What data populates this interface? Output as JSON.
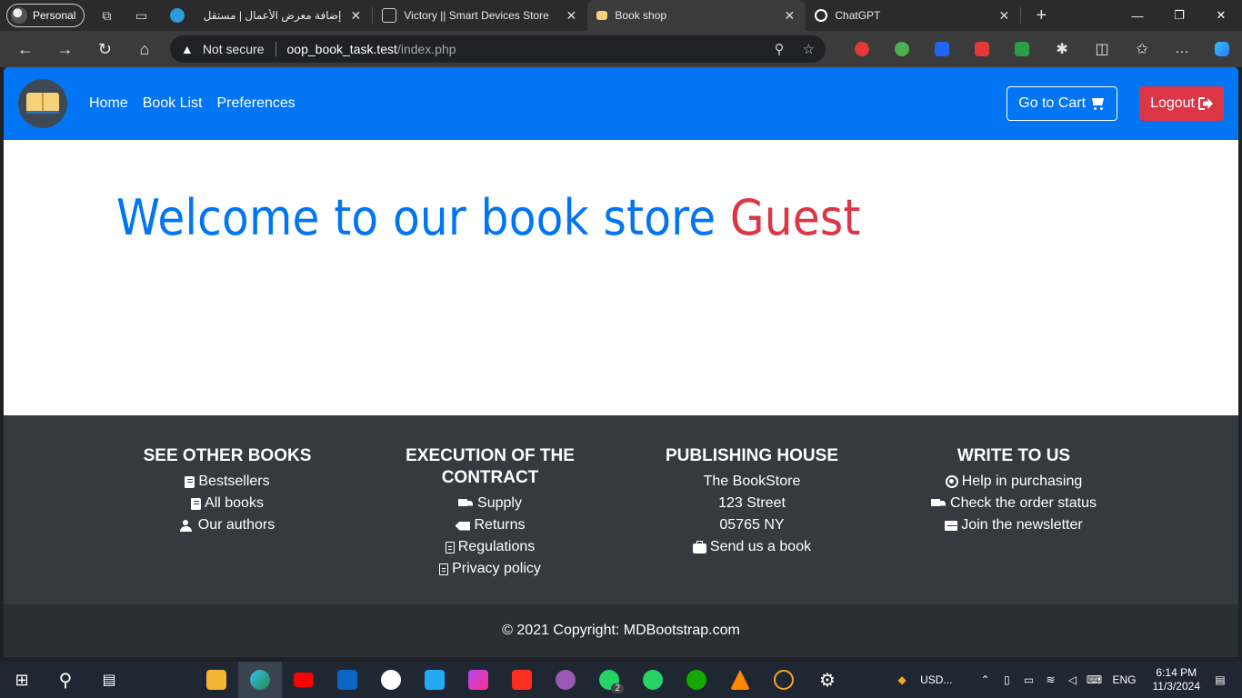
{
  "browser": {
    "profile_label": "Personal",
    "tabs": [
      {
        "title": "إضافة معرض الأعمال | مستقل",
        "favicon_color": "#2d9cdb",
        "active": false
      },
      {
        "title": "Victory || Smart Devices Store",
        "favicon_color": "#cccccc",
        "active": false
      },
      {
        "title": "Book shop",
        "favicon_color": "#f5d27a",
        "active": true
      },
      {
        "title": "ChatGPT",
        "favicon_color": "#ffffff",
        "active": false
      }
    ],
    "security_label": "Not secure",
    "url_host": "oop_book_task.test",
    "url_path": "/index.php"
  },
  "navbar": {
    "links": [
      "Home",
      "Book List",
      "Preferences"
    ],
    "cart_label": "Go to Cart",
    "logout_label": "Logout",
    "brand_color": "#0275f5"
  },
  "hero": {
    "welcome_text": "Welcome to our book store ",
    "user_name": "Guest",
    "text_color": "#0275f5",
    "name_color": "#dc3545"
  },
  "footer": {
    "columns": [
      {
        "heading": "SEE OTHER BOOKS",
        "items": [
          {
            "icon": "book-icon",
            "label": "Bestsellers"
          },
          {
            "icon": "book-icon",
            "label": "All books"
          },
          {
            "icon": "user-edit-icon",
            "label": "Our authors"
          }
        ]
      },
      {
        "heading": "EXECUTION OF THE CONTRACT",
        "items": [
          {
            "icon": "truck-icon",
            "label": "Supply"
          },
          {
            "icon": "backspace-icon",
            "label": "Returns"
          },
          {
            "icon": "file-icon",
            "label": "Regulations"
          },
          {
            "icon": "file-icon",
            "label": "Privacy policy"
          }
        ]
      },
      {
        "heading": "PUBLISHING HOUSE",
        "items": [
          {
            "icon": "",
            "label": "The BookStore"
          },
          {
            "icon": "",
            "label": "123 Street"
          },
          {
            "icon": "",
            "label": "05765 NY"
          },
          {
            "icon": "briefcase-icon",
            "label": "Send us a book"
          }
        ]
      },
      {
        "heading": "WRITE TO US",
        "items": [
          {
            "icon": "at-icon",
            "label": "Help in purchasing"
          },
          {
            "icon": "truck-icon",
            "label": "Check the order status"
          },
          {
            "icon": "envelope-icon",
            "label": "Join the newsletter"
          }
        ]
      }
    ],
    "copyright": "© 2021 Copyright: MDBootstrap.com",
    "background_color": "#343a40"
  },
  "taskbar": {
    "tray_weather": "USD...",
    "language": "ENG",
    "time": "6:14 PM",
    "date": "11/3/2024",
    "whatsapp_badge": "2"
  }
}
